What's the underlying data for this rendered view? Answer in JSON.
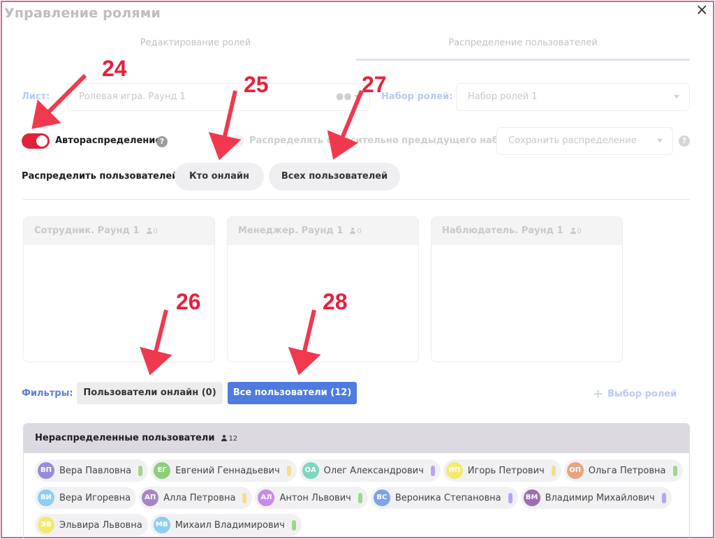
{
  "modal": {
    "title": "Управление ролями",
    "close": "×"
  },
  "tabs": [
    {
      "label": "Редактирование ролей"
    },
    {
      "label": "Распределение пользователей"
    }
  ],
  "form": {
    "sheet_label": "Лист:",
    "sheet_value": "Ролевая игра. Раунд 1",
    "roleset_label": "Набор ролей:",
    "roleset_value": "Набор ролей 1",
    "auto_label": "Автораспределение",
    "relative_label": "Распределять относительно предыдущего набора",
    "save_placeholder": "Сохранить распределение",
    "help": "?"
  },
  "distribute": {
    "label": "Распределить пользователей:",
    "online_btn": "Кто онлайн",
    "all_btn": "Всех пользователей"
  },
  "roles": [
    {
      "title": "Сотрудник. Раунд 1",
      "count": "0"
    },
    {
      "title": "Менеджер. Раунд 1",
      "count": "0"
    },
    {
      "title": "Наблюдатель. Раунд 1",
      "count": "0"
    }
  ],
  "filters": {
    "label": "Фильтры:",
    "online": "Пользователи онлайн (0)",
    "all": "Все пользователи (12)",
    "choose_roles": "Выбор ролей",
    "plus": "+"
  },
  "unassigned": {
    "title": "Нераспределенные пользователи",
    "count": "12",
    "users": [
      {
        "initials": "ВП",
        "name": "Вера Павловна",
        "avatar_color": "#9a8bd9",
        "status_color": "#9fd68a"
      },
      {
        "initials": "ЕГ",
        "name": "Евгений Геннадьевич",
        "avatar_color": "#8fcf7a",
        "status_color": "#f7dc8a"
      },
      {
        "initials": "ОА",
        "name": "Олег Александрович",
        "avatar_color": "#7fd6c0",
        "status_color": "#b7a4f0"
      },
      {
        "initials": "ИП",
        "name": "Игорь Петрович",
        "avatar_color": "#f2ea6f",
        "status_color": "#f7dc8a"
      },
      {
        "initials": "ОП",
        "name": "Ольга Петровна",
        "avatar_color": "#e3a582",
        "status_color": "#9fd68a"
      },
      {
        "initials": "ВИ",
        "name": "Вера Игоревна",
        "avatar_color": "#8fcdf2",
        "status_color": ""
      },
      {
        "initials": "АП",
        "name": "Алла Петровна",
        "avatar_color": "#a785c2",
        "status_color": "#f7dc8a"
      },
      {
        "initials": "АЛ",
        "name": "Антон Львович",
        "avatar_color": "#c98ae6",
        "status_color": "#9fd68a"
      },
      {
        "initials": "ВС",
        "name": "Вероника Степановна",
        "avatar_color": "#7ea3e6",
        "status_color": "#b7a4f0"
      },
      {
        "initials": "ВМ",
        "name": "Владимир Михайлович",
        "avatar_color": "#9d6fb0",
        "status_color": "#b7a4f0"
      },
      {
        "initials": "ЭВ",
        "name": "Эльвира Львовна",
        "avatar_color": "#f2ea6f",
        "status_color": ""
      },
      {
        "initials": "МВ",
        "name": "Михаил Владимирович",
        "avatar_color": "#8fcdf2",
        "status_color": "#9fd68a"
      }
    ]
  },
  "annotations": [
    {
      "number": "24"
    },
    {
      "number": "25"
    },
    {
      "number": "26"
    },
    {
      "number": "27"
    },
    {
      "number": "28"
    }
  ],
  "colors": {
    "accent": "#e8203b",
    "primary": "#4f7bdf",
    "frame": "#c56b96"
  }
}
